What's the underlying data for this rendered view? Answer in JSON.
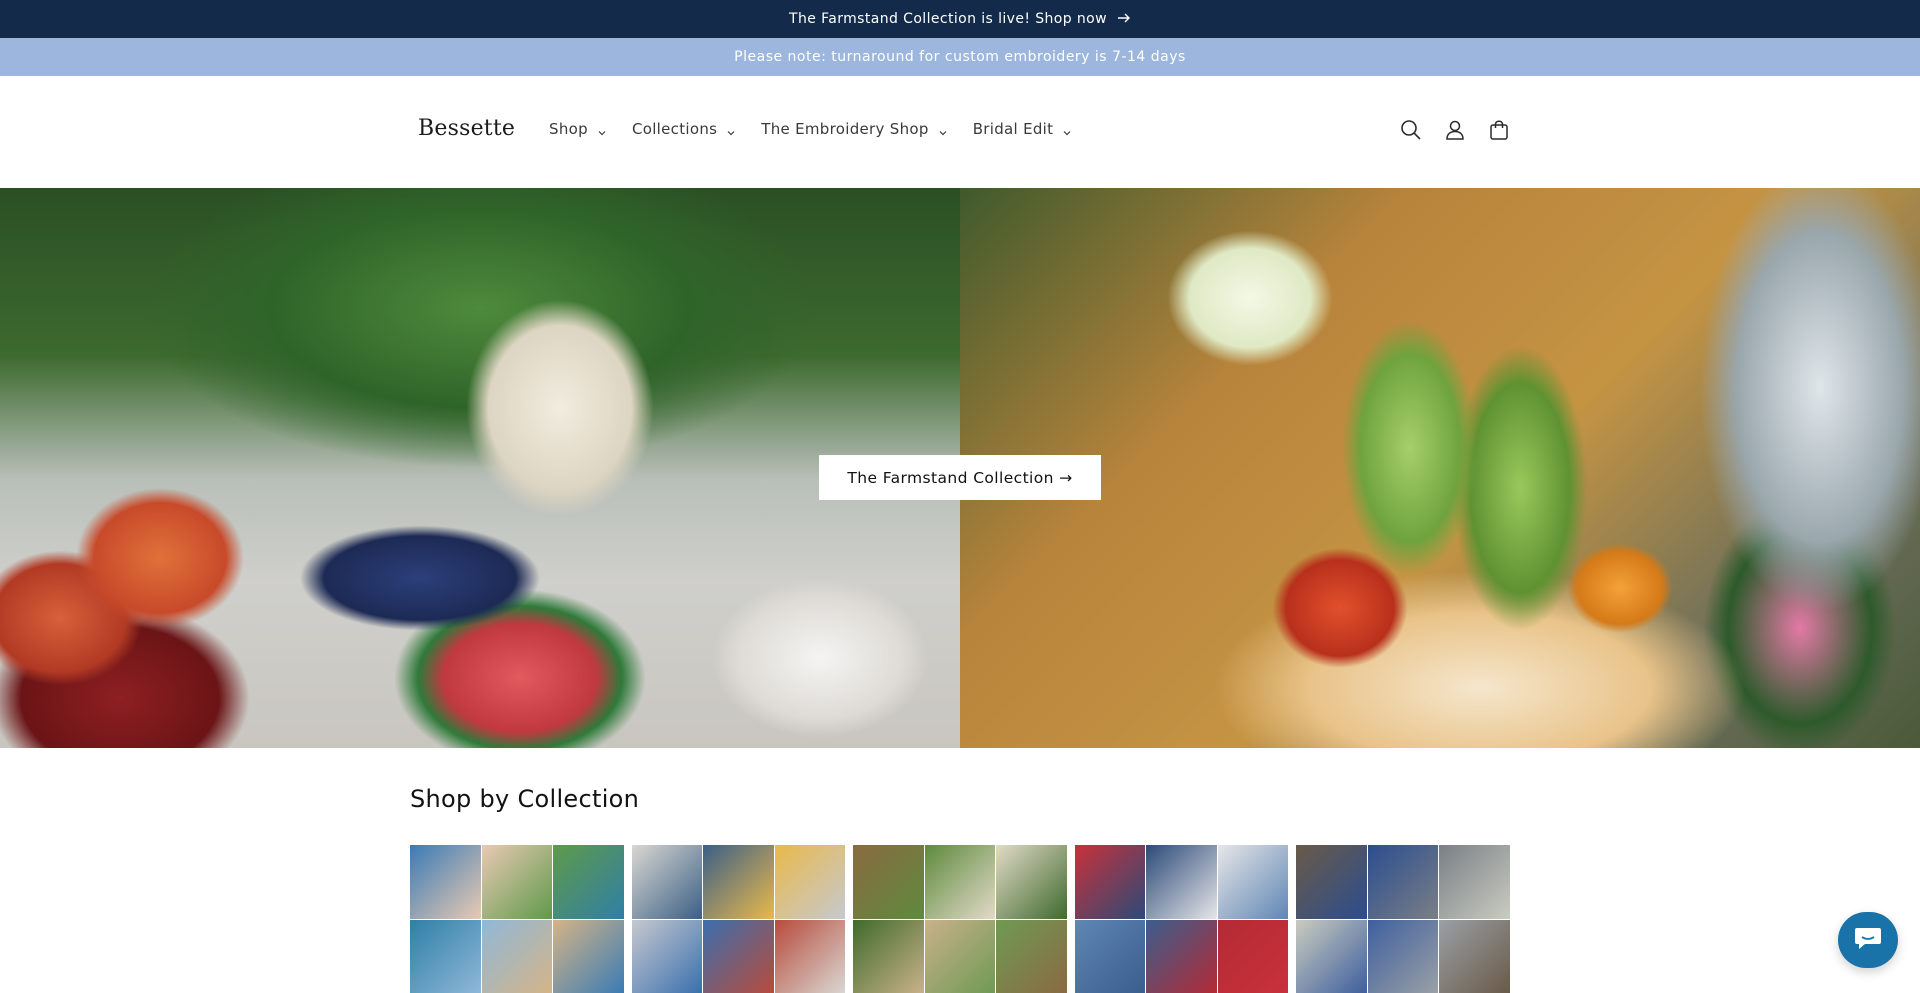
{
  "announcement": {
    "primary_text": "The Farmstand Collection is live! Shop now",
    "secondary_text": "Please note: turnaround for custom embroidery is 7-14 days",
    "primary_bg": "#132a4b",
    "secondary_bg": "#9cb6dd"
  },
  "header": {
    "logo": "Bessette",
    "nav": [
      {
        "label": "Shop"
      },
      {
        "label": "Collections"
      },
      {
        "label": "The Embroidery Shop"
      },
      {
        "label": "Bridal Edit"
      }
    ],
    "icons": [
      "search-icon",
      "account-icon",
      "cart-icon"
    ]
  },
  "hero": {
    "button_label": "The Farmstand Collection →"
  },
  "collections_section": {
    "title": "Shop by Collection",
    "cards": [
      {
        "name": "collection-card-1",
        "palette": [
          "#3a7bb5",
          "#e9c9b4",
          "#5f9a4a",
          "#2f7fa6",
          "#8fb8d9",
          "#d5b487"
        ]
      },
      {
        "name": "collection-card-2",
        "palette": [
          "#d9d7d2",
          "#3b5f86",
          "#e9b94a",
          "#c6c9cf",
          "#3a6fae",
          "#b84b3c"
        ]
      },
      {
        "name": "collection-card-3",
        "palette": [
          "#8a6a42",
          "#5e8a3d",
          "#e2dac8",
          "#3f6a2c",
          "#c9b18a",
          "#6f9a54"
        ]
      },
      {
        "name": "collection-card-4",
        "palette": [
          "#c8313a",
          "#2b4a78",
          "#e6e6e8",
          "#5f86b5",
          "#3a5e8e",
          "#b42a35"
        ]
      },
      {
        "name": "collection-card-5",
        "palette": [
          "#6a5a48",
          "#2b4d8f",
          "#7a7f86",
          "#c9ccc0",
          "#3e5f9e",
          "#9aa0a6"
        ]
      }
    ]
  },
  "chat": {
    "icon": "chat-icon",
    "color": "#1a73a8"
  }
}
